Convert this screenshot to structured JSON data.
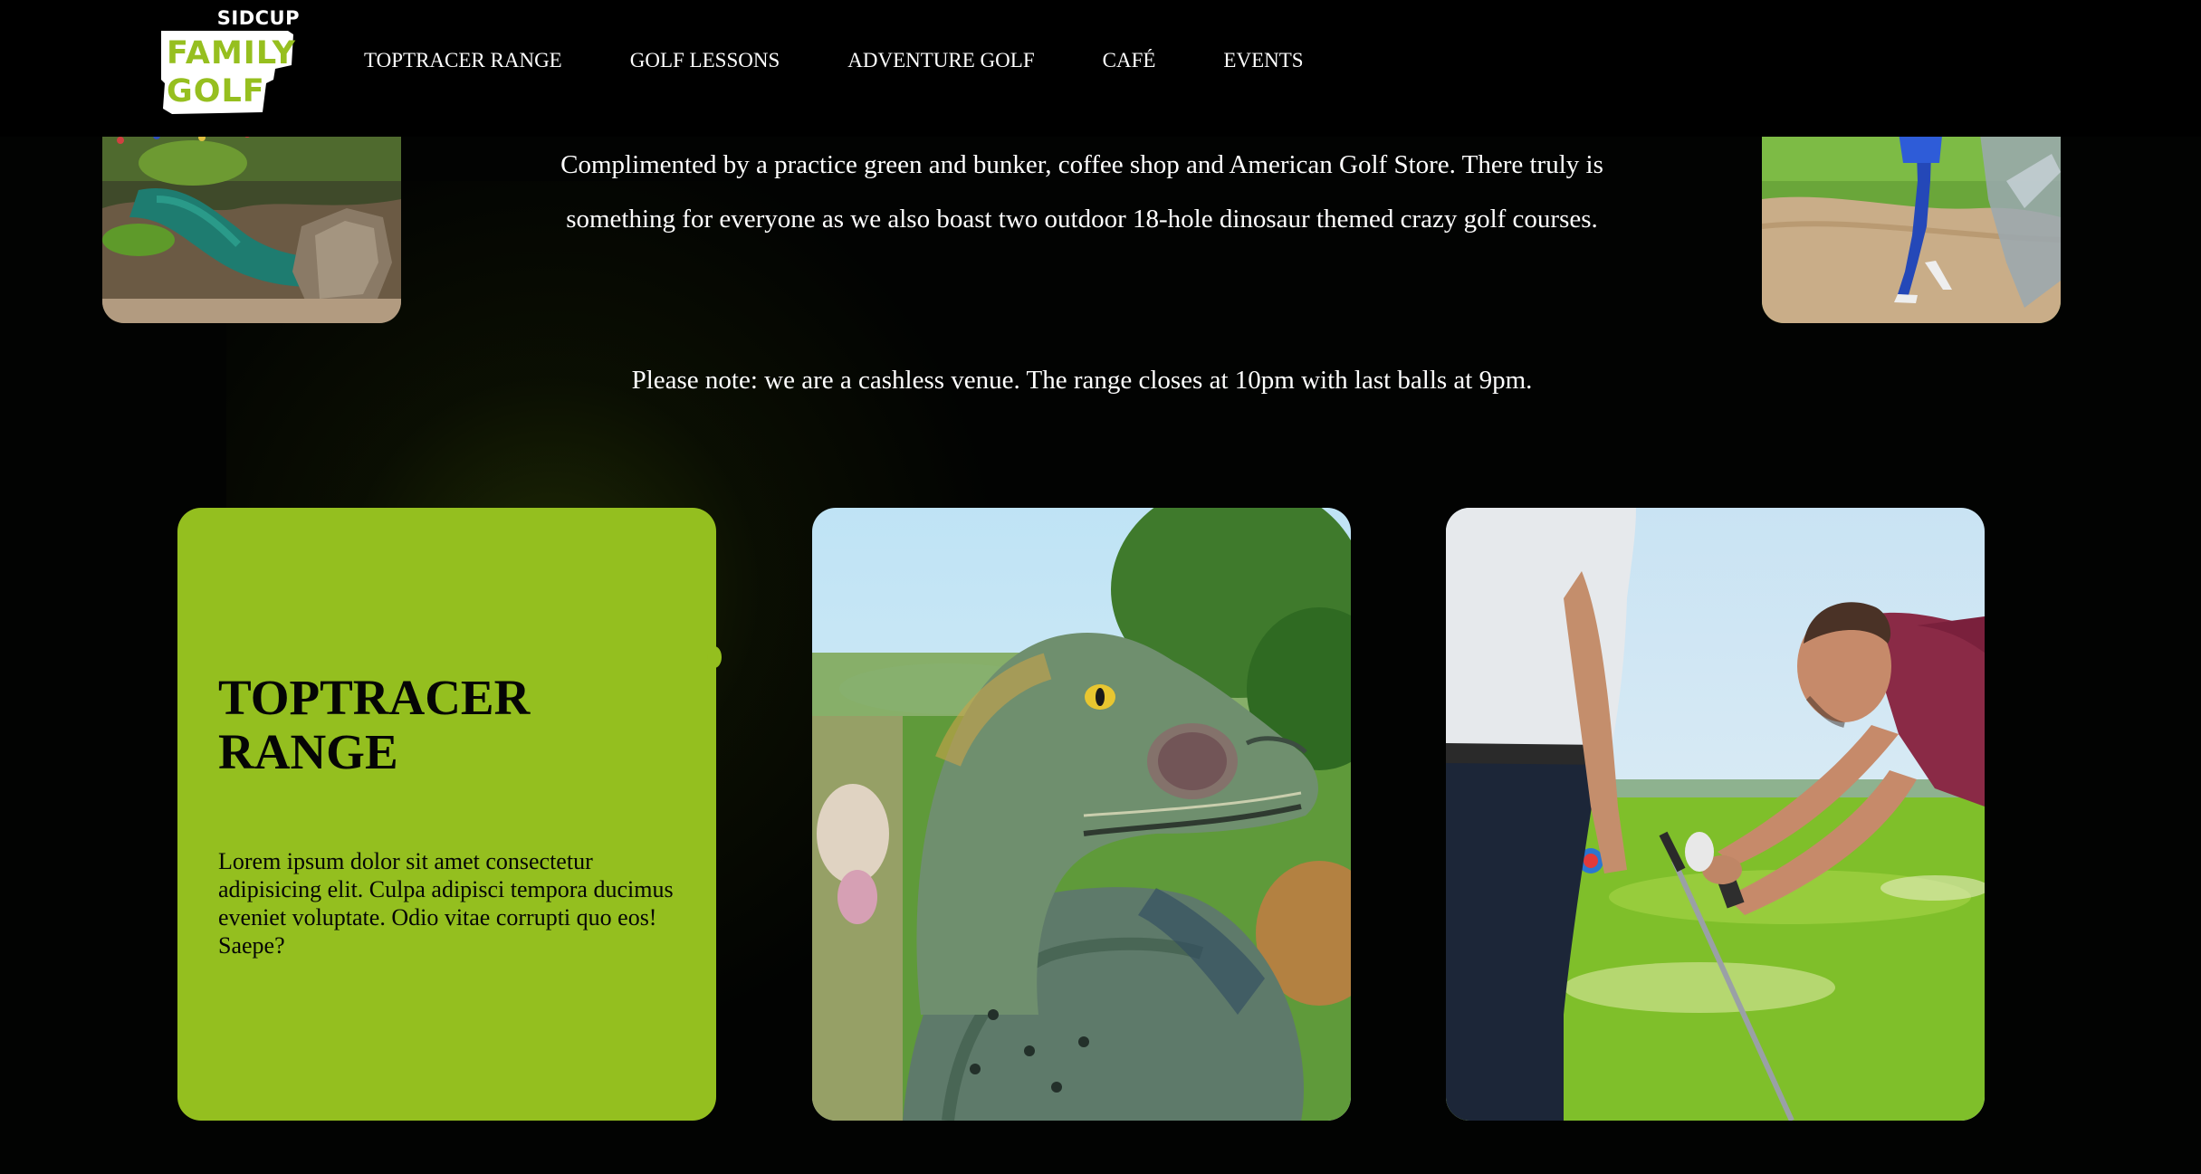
{
  "header": {
    "logo": {
      "top_text": "SIDCUP",
      "line1": "FAMILY",
      "line2": "GOLF"
    },
    "nav": [
      {
        "label": "TOPTRACER RANGE"
      },
      {
        "label": "GOLF LESSONS"
      },
      {
        "label": "ADVENTURE GOLF"
      },
      {
        "label": "CAFÉ"
      },
      {
        "label": "EVENTS"
      }
    ]
  },
  "main": {
    "intro": "Complimented by a practice green and bunker, coffee shop and American Golf Store. There truly is something for everyone as we also boast two outdoor 18-hole dinosaur themed crazy golf courses.",
    "note": "Please note: we are a cashless venue. The range closes at 10pm with last balls at 9pm."
  },
  "cards": {
    "feature": {
      "title": "TOPTRACER RANGE",
      "body": "Lorem ipsum dolor sit amet consectetur adipisicing elit. Culpa adipisci tempora ducimus eveniet voluptate. Odio vitae corrupti quo eos! Saepe?"
    }
  },
  "colors": {
    "background": "#020302",
    "accent_green": "#94bf1f",
    "text": "#ffffff"
  }
}
